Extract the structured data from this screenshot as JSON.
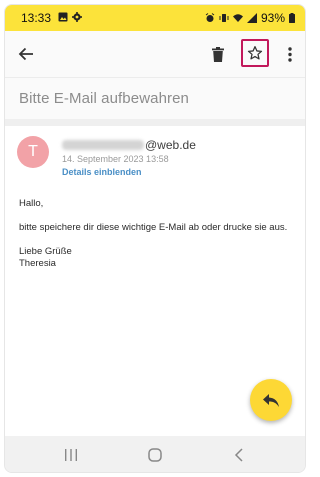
{
  "status_bar": {
    "time": "13:33",
    "battery": "93%"
  },
  "toolbar": {
    "back_icon": "arrow-left-icon",
    "delete_icon": "trash-icon",
    "star_icon": "star-outline-icon",
    "more_icon": "more-vert-icon",
    "highlight_color": "#c2185b"
  },
  "email": {
    "subject": "Bitte E-Mail aufbewahren",
    "avatar_letter": "T",
    "avatar_color": "#f2a2a7",
    "sender_domain": "@web.de",
    "date": "14. September 2023 13:58",
    "details_link": "Details einblenden",
    "body": {
      "greeting": "Hallo,",
      "paragraph": "bitte speichere dir diese wichtige E-Mail ab oder drucke sie aus.",
      "closing": "Liebe Grüße",
      "signature": "Theresia"
    }
  },
  "fab": {
    "icon": "reply-icon",
    "color": "#fdd835"
  },
  "nav_bar": {
    "recent_icon": "recent-apps-icon",
    "home_icon": "home-icon",
    "back_icon": "nav-back-icon"
  },
  "colors": {
    "status_bar": "#fce33a",
    "link": "#4a8fc6"
  }
}
